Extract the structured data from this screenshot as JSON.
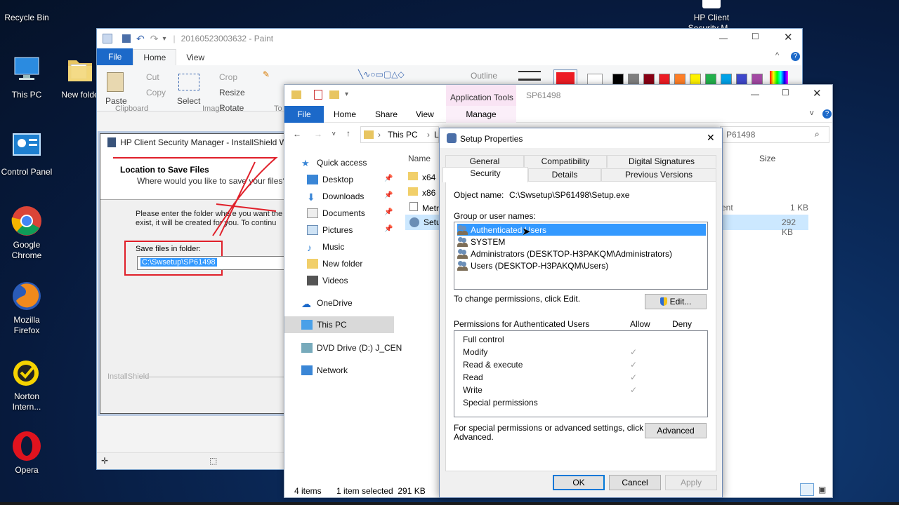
{
  "desktop": {
    "icons": [
      {
        "label": "Recycle Bin"
      },
      {
        "label": "This PC"
      },
      {
        "label": "New folde"
      },
      {
        "label": "Control Panel"
      },
      {
        "label": "Google Chrome"
      },
      {
        "label": "Mozilla Firefox"
      },
      {
        "label": "Norton Intern..."
      },
      {
        "label": "Opera"
      },
      {
        "label": "HP Client Security M..."
      }
    ]
  },
  "paint": {
    "title": "20160523003632 - Paint",
    "tabs": [
      "File",
      "Home",
      "View"
    ],
    "clipboard": {
      "paste": "Paste",
      "cut": "Cut",
      "copy": "Copy",
      "group": "Clipboard"
    },
    "image": {
      "select": "Select",
      "crop": "Crop",
      "resize": "Resize",
      "rotate": "Rotate",
      "group": "Image"
    },
    "tools_group": "To",
    "outline": "Outline",
    "colors": [
      "#000000",
      "#7f7f7f",
      "#880015",
      "#ed1c24",
      "#ff7f27",
      "#fff200",
      "#22b14c",
      "#00a2e8",
      "#3f48cc",
      "#a349a4"
    ],
    "color1": "#ed1c24"
  },
  "installshield": {
    "title": "HP Client Security Manager - InstallShield W",
    "heading": "Location to Save Files",
    "subheading": "Where would you like to save your files?",
    "body_line1": "Please enter the folder where you want the",
    "body_line2": "exist, it will be created for you.  To continu",
    "field_label": "Save files in folder:",
    "field_value": "C:\\Swsetup\\SP61498",
    "brand": "InstallShield"
  },
  "explorer": {
    "context_tab": "Application Tools",
    "title": "SP61498",
    "ribbon_tabs": [
      "File",
      "Home",
      "Share",
      "View",
      "Manage"
    ],
    "address": [
      "This PC",
      "Lo"
    ],
    "search_text": "P61498",
    "nav": [
      {
        "label": "Quick access"
      },
      {
        "label": "Desktop"
      },
      {
        "label": "Downloads"
      },
      {
        "label": "Documents"
      },
      {
        "label": "Pictures"
      },
      {
        "label": "Music"
      },
      {
        "label": "New folder"
      },
      {
        "label": "Videos"
      },
      {
        "label": "OneDrive"
      },
      {
        "label": "This PC"
      },
      {
        "label": "DVD Drive (D:) J_CEN"
      },
      {
        "label": "Network"
      }
    ],
    "col_name": "Name",
    "col_size": "Size",
    "files": [
      {
        "name": "x64"
      },
      {
        "name": "x86"
      },
      {
        "name": "Metr"
      },
      {
        "name": "Setu"
      }
    ],
    "file_type_partial": "ent",
    "sizes": [
      "1 KB",
      "292 KB"
    ],
    "status_items": "4 items",
    "status_selected": "1 item selected  291 KB"
  },
  "dialog": {
    "title": "Setup Properties",
    "tabs_row1": [
      "General",
      "Compatibility",
      "Digital Signatures"
    ],
    "tabs_row2": [
      "Security",
      "Details",
      "Previous Versions"
    ],
    "object_label": "Object name:",
    "object_value": "C:\\Swsetup\\SP61498\\Setup.exe",
    "group_label": "Group or user names:",
    "users": [
      "Authenticated Users",
      "SYSTEM",
      "Administrators (DESKTOP-H3PAKQM\\Administrators)",
      "Users (DESKTOP-H3PAKQM\\Users)"
    ],
    "change_text": "To change permissions, click Edit.",
    "edit_label": "Edit...",
    "perm_header": "Permissions for Authenticated Users",
    "allow": "Allow",
    "deny": "Deny",
    "permissions": [
      {
        "name": "Full control",
        "allow": false
      },
      {
        "name": "Modify",
        "allow": true
      },
      {
        "name": "Read & execute",
        "allow": true
      },
      {
        "name": "Read",
        "allow": true
      },
      {
        "name": "Write",
        "allow": true
      },
      {
        "name": "Special permissions",
        "allow": false
      }
    ],
    "special_line1": "For special permissions or advanced settings, click",
    "special_line2": "Advanced.",
    "advanced_label": "Advanced",
    "ok": "OK",
    "cancel": "Cancel",
    "apply": "Apply"
  }
}
